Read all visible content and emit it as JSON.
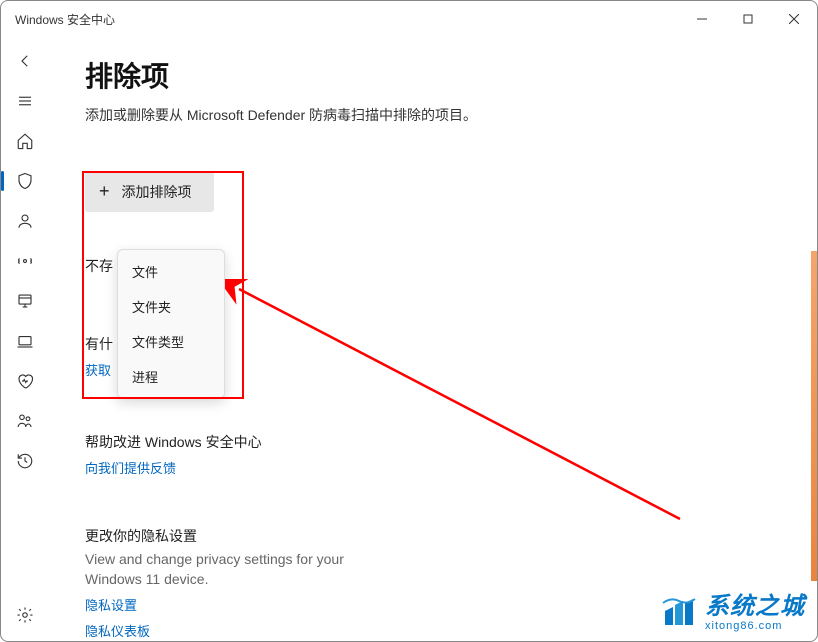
{
  "window": {
    "title": "Windows 安全中心"
  },
  "page": {
    "title": "排除项",
    "subtitle": "添加或删除要从 Microsoft Defender 防病毒扫描中排除的项目。"
  },
  "addButton": {
    "label": "添加排除项"
  },
  "dropdown": {
    "items": [
      {
        "label": "文件"
      },
      {
        "label": "文件夹"
      },
      {
        "label": "文件类型"
      },
      {
        "label": "进程"
      }
    ]
  },
  "hiddenText": {
    "noExist": "不存",
    "hasWhat": "有什",
    "getLink": "获取"
  },
  "helpSection": {
    "heading": "帮助改进 Windows 安全中心",
    "link": "向我们提供反馈"
  },
  "privacySection": {
    "heading": "更改你的隐私设置",
    "description": "View and change privacy settings for your Windows 11 device.",
    "link1": "隐私设置",
    "link2": "隐私仪表板"
  },
  "watermark": {
    "main": "系统之城",
    "sub": "xitong86.com"
  }
}
